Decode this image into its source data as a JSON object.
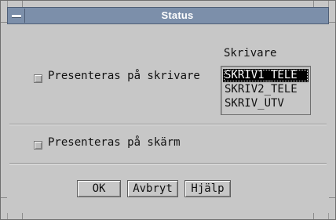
{
  "window": {
    "title": "Status"
  },
  "printer_section": {
    "checkbox_label": "Presenteras på skrivare",
    "list_heading": "Skrivare",
    "printers": [
      "SKRIV1_TELE",
      "SKRIV2_TELE",
      "SKRIV_UTV"
    ],
    "selected_printer": "SKRIV1_TELE"
  },
  "screen_section": {
    "checkbox_label": "Presenteras på skärm"
  },
  "buttons": {
    "ok": "OK",
    "cancel": "Avbryt",
    "help": "Hjälp"
  },
  "colors": {
    "titlebar": "#7c8faa",
    "dialog_bg": "#c7c7c7"
  }
}
